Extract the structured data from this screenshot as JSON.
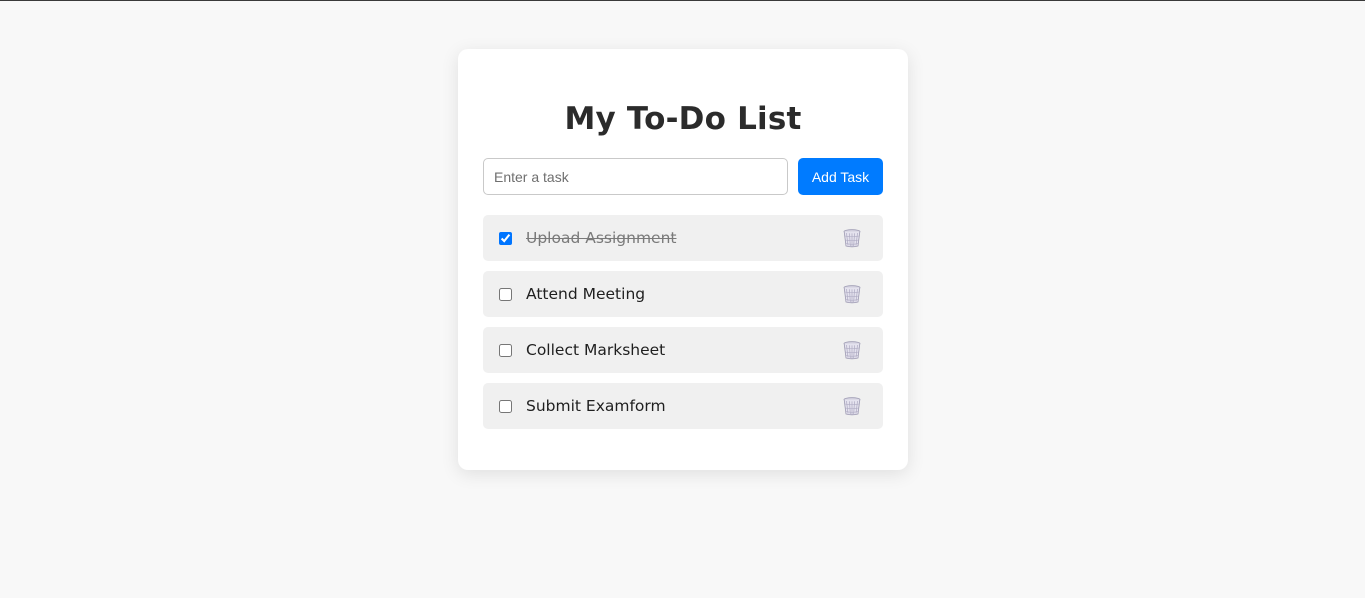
{
  "app": {
    "title": "My To-Do List"
  },
  "input": {
    "placeholder": "Enter a task",
    "value": "",
    "add_label": "Add Task"
  },
  "tasks": [
    {
      "text": "Upload Assignment",
      "done": true
    },
    {
      "text": "Attend Meeting",
      "done": false
    },
    {
      "text": "Collect Marksheet",
      "done": false
    },
    {
      "text": "Submit Examform",
      "done": false
    }
  ],
  "icons": {
    "delete": "wastebasket-icon"
  },
  "colors": {
    "accent": "#007bff",
    "background": "#f8f8f8",
    "card": "#ffffff",
    "item": "#f0f0f0"
  }
}
